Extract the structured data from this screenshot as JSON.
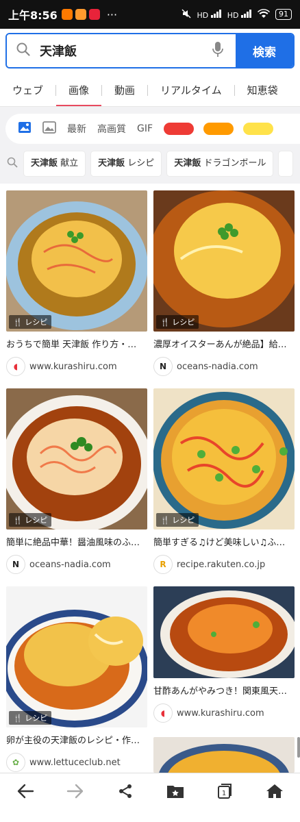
{
  "status": {
    "time": "上午8:56",
    "signal": "HD",
    "battery": "91"
  },
  "search": {
    "query": "天津飯",
    "button_label": "検索"
  },
  "tabs": [
    {
      "label": "ウェブ",
      "active": false
    },
    {
      "label": "画像",
      "active": true
    },
    {
      "label": "動画",
      "active": false
    },
    {
      "label": "リアルタイム",
      "active": false
    },
    {
      "label": "知恵袋",
      "active": false
    }
  ],
  "filters": {
    "latest": "最新",
    "hq": "高画質",
    "gif": "GIF",
    "colors": [
      "#ee3b35",
      "#ff9a00",
      "#ffe24a"
    ]
  },
  "suggestions": [
    {
      "bold": "天津飯",
      "rest": " 献立"
    },
    {
      "bold": "天津飯",
      "rest": " レシピ"
    },
    {
      "bold": "天津飯",
      "rest": " ドラゴンボール"
    }
  ],
  "badge_label": "レシピ",
  "results": [
    {
      "title": "おうちで簡単 天津飯 作り方・…",
      "site": "www.kurashiru.com",
      "favicon": "kurashiru"
    },
    {
      "title": "濃厚オイスターあんが絶品】給…",
      "site": "oceans-nadia.com",
      "favicon": "nadia"
    },
    {
      "title": "簡単に絶品中華！醤油風味のふ…",
      "site": "oceans-nadia.com",
      "favicon": "nadia"
    },
    {
      "title": "簡単すぎる♫けど美味しい♫ふ…",
      "site": "recipe.rakuten.co.jp",
      "favicon": "rakuten"
    },
    {
      "title": "卵が主役の天津飯のレシピ・作…",
      "site": "www.lettuceclub.net",
      "favicon": "lettuce"
    },
    {
      "title": "甘酢あんがやみつき！関東風天…",
      "site": "www.kurashiru.com",
      "favicon": "kurashiru"
    }
  ],
  "colors": {
    "accent": "#1f6fe6",
    "tab_indicator": "#e84a5f"
  }
}
